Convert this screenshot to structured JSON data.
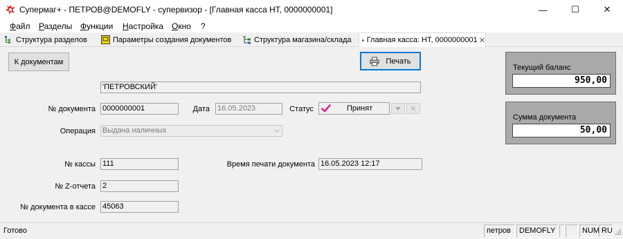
{
  "window": {
    "title": "Супермаг+ - ПЕТРОВ@DEMOFLY - супервизор  - [Главная касса НТ, 0000000001]",
    "minimize": "—",
    "maximize": "☐",
    "close": "✕"
  },
  "menu": [
    "Файл",
    "Разделы",
    "Функции",
    "Настройка",
    "Окно",
    "?"
  ],
  "tabs": [
    {
      "label": "Структура разделов",
      "icon": "tree-icon"
    },
    {
      "label": "Параметры создания документов",
      "icon": "document-settings-icon"
    },
    {
      "label": "Структура магазина/склада",
      "icon": "store-structure-icon"
    },
    {
      "label": "Главная касса: НТ, 0000000001",
      "icon": "cash-register-icon",
      "active": true,
      "close": "✕"
    }
  ],
  "buttons": {
    "to_documents": "К документам",
    "print": "Печать"
  },
  "form": {
    "name": "'ПЕТРОВСКИЙ'",
    "doc_number_label": "№ документа",
    "doc_number": "0000000001",
    "date_label": "Дата",
    "date": "16.05.2023",
    "status_label": "Статус",
    "status": "Принят",
    "operation_label": "Операция",
    "operation": "Выдача наличных",
    "register_label": "№ кассы",
    "register": "111",
    "print_time_label": "Время печати документа",
    "print_time": "16.05.2023 12:17",
    "z_report_label": "№ Z-отчета",
    "z_report": "2",
    "register_doc_label": "№ документа в кассе",
    "register_doc": "45063"
  },
  "balance": {
    "current_label": "Текущий баланс",
    "current_value": "950,00",
    "doc_sum_label": "Сумма документа",
    "doc_sum_value": "50,00"
  },
  "statusbar": {
    "text": "Готово",
    "user": "петров",
    "db": "DEMOFLY",
    "num": "NUM",
    "lang": "RU"
  },
  "colors": {
    "status_check": "#e0208a",
    "focus": "#0078d7"
  }
}
